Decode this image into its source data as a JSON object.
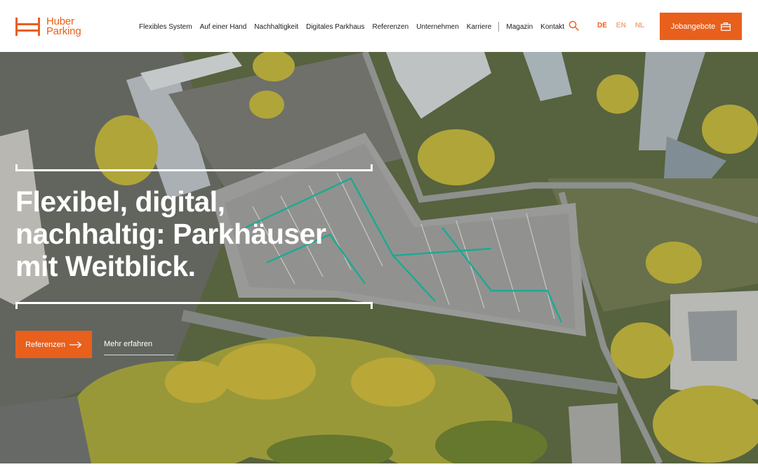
{
  "brand": {
    "line1": "Huber",
    "line2": "Parking",
    "color": "#e8601c"
  },
  "nav": {
    "items": [
      "Flexibles System",
      "Auf einer Hand",
      "Nachhaltigkeit",
      "Digitales Parkhaus",
      "Referenzen",
      "Unternehmen",
      "Karriere"
    ],
    "secondary": [
      "Magazin",
      "Kontakt"
    ]
  },
  "search": {
    "icon": "search-icon"
  },
  "languages": {
    "de": "DE",
    "en": "EN",
    "nl": "NL",
    "active": "DE"
  },
  "jobs_button": {
    "label": "Jobangebote",
    "icon": "briefcase-icon"
  },
  "hero": {
    "headline": [
      "Flexibel, digital,",
      "nachhaltig: Parkhäuser",
      "mit Weitblick."
    ],
    "cta_label": "Referenzen",
    "more_label": "Mehr erfahren"
  },
  "colors": {
    "accent": "#e8601c",
    "marking": "#1fb8a0"
  }
}
